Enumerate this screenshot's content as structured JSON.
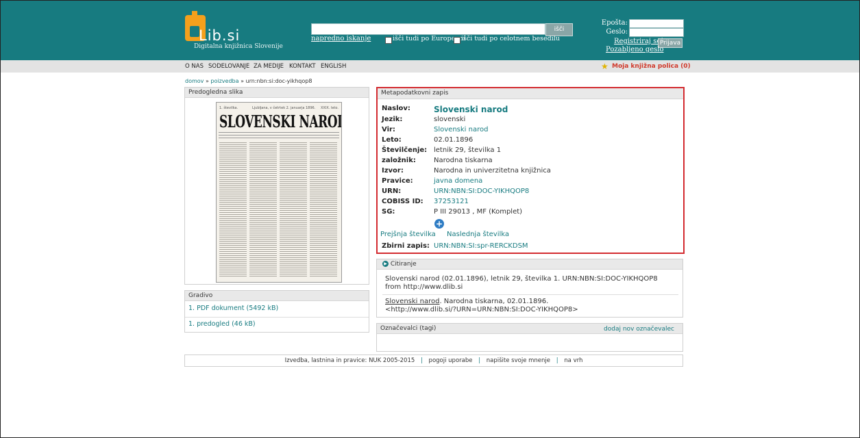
{
  "logo": {
    "text": "Lib.si",
    "subtitle": "Digitalna knjižnica Slovenije"
  },
  "search": {
    "button": "išči",
    "advanced": "napredno iskanje",
    "europeana": "išči tudi po Europeani",
    "fulltext": "išči tudi po celotnem besedilu"
  },
  "login": {
    "email_label": "Epošta:",
    "password_label": "Geslo:",
    "register": "Registriraj se!",
    "forgot": "Pozabljeno geslo",
    "submit": "Prijava"
  },
  "nav": {
    "items": [
      "O NAS",
      "SODELOVANJE",
      "ZA MEDIJE",
      "KONTAKT",
      "ENGLISH"
    ],
    "shelf": "Moja knjižna polica (0)"
  },
  "breadcrumb": {
    "home": "domov",
    "search": "poizvedba",
    "current": "urn:nbn:si:doc-yikhqop8",
    "sep": "»"
  },
  "preview": {
    "title": "Predogledna slika",
    "news_header_left": "1. številka.",
    "news_header_mid": "Ljubljana, v četrtek 2. januarja 1896.",
    "news_header_right": "XXIX. leto.",
    "news_title": "SLOVENSKI NAROD."
  },
  "gradivo": {
    "title": "Gradivo",
    "items": [
      "1. PDF dokument (5492 kB)",
      "1. predogled (46 kB)"
    ]
  },
  "metadata": {
    "title": "Metapodatkovni zapis",
    "rows": [
      {
        "key": "Naslov:",
        "value": "Slovenski narod"
      },
      {
        "key": "Jezik:",
        "value": "slovenski"
      },
      {
        "key": "Vir:",
        "value": "Slovenski narod"
      },
      {
        "key": "Leto:",
        "value": "02.01.1896"
      },
      {
        "key": "Številčenje:",
        "value": "letnik 29, številka 1"
      },
      {
        "key": "založnik:",
        "value": "Narodna tiskarna"
      },
      {
        "key": "Izvor:",
        "value": "Narodna in univerzitetna knjižnica"
      },
      {
        "key": "Pravice:",
        "value": "javna domena"
      },
      {
        "key": "URN:",
        "value": "URN:NBN:SI:DOC-YIKHQOP8"
      },
      {
        "key": "COBISS ID:",
        "value": "37253121"
      },
      {
        "key": "SG:",
        "value": "P III 29013 , MF (Komplet)"
      }
    ],
    "prev": "Prejšnja številka",
    "next": "Naslednja številka",
    "collection_key": "Zbirni zapis:",
    "collection_value": "URN:NBN:SI:spr-RERCKDSM"
  },
  "citation": {
    "title": "Citiranje",
    "text1": "Slovenski narod (02.01.1896), letnik 29, številka 1. URN:NBN:SI:DOC-YIKHQOP8 from http://www.dlib.si",
    "text2a": "Slovenski narod",
    "text2b": ". Narodna tiskarna, 02.01.1896.",
    "text2c": "<http://www.dlib.si/?URN=URN:NBN:SI:DOC-YIKHQOP8>"
  },
  "tags": {
    "title": "Označevalci (tagi)",
    "add": "dodaj nov označevalec"
  },
  "footer": {
    "credits": "Izvedba, lastnina in pravice: NUK 2005-2015",
    "terms": "pogoji uporabe",
    "feedback": "napišite svoje mnenje",
    "top": "na vrh",
    "sep": "|"
  }
}
